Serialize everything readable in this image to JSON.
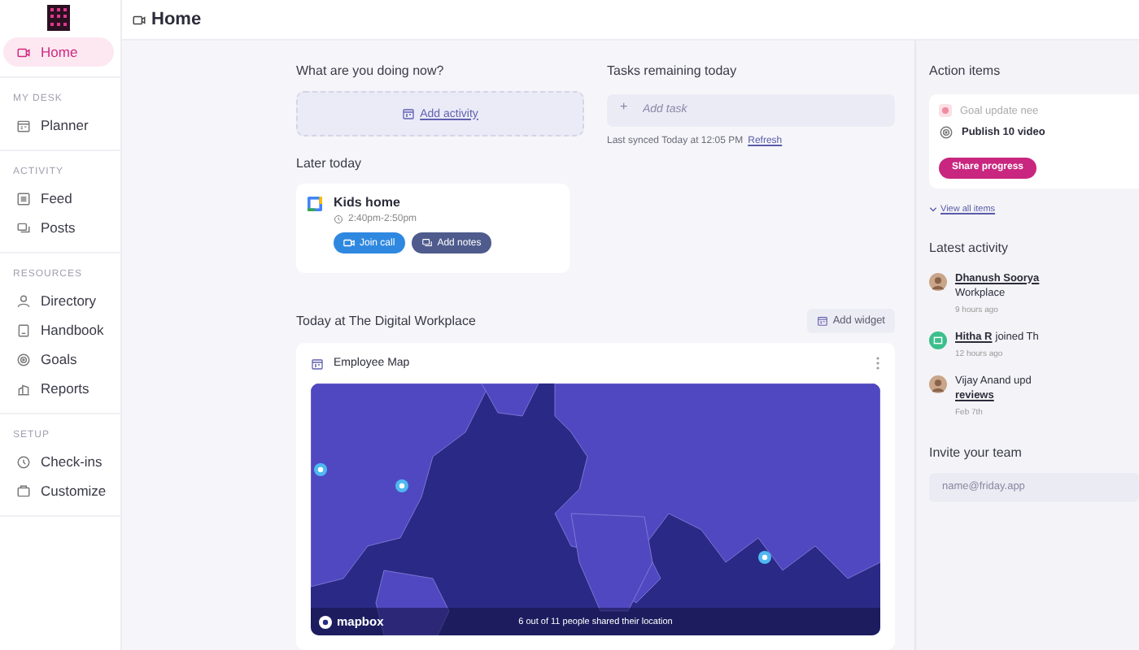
{
  "header": {
    "title": "Home"
  },
  "sidebar": {
    "sections": [
      {
        "items": [
          {
            "label": "Home",
            "selected": true
          }
        ]
      },
      {
        "heading": "MY DESK",
        "items": [
          {
            "label": "Planner",
            "selected": false
          }
        ]
      },
      {
        "heading": "ACTIVITY",
        "items": [
          {
            "label": "Feed",
            "selected": false
          },
          {
            "label": "Posts",
            "selected": false
          }
        ]
      },
      {
        "heading": "RESOURCES",
        "items": [
          {
            "label": "Directory",
            "selected": false
          },
          {
            "label": "Handbook",
            "selected": false
          },
          {
            "label": "Goals",
            "selected": false
          },
          {
            "label": "Reports",
            "selected": false
          }
        ]
      },
      {
        "heading": "SETUP",
        "items": [
          {
            "label": "Check-ins",
            "selected": false
          },
          {
            "label": "Customize",
            "selected": false
          }
        ]
      }
    ]
  },
  "now": {
    "title": "What are you doing now?",
    "action": "Add activity"
  },
  "tasks": {
    "title": "Tasks remaining today",
    "plus": "+",
    "placeholder": "Add task",
    "synced": "Last synced Today at 12:05 PM",
    "refresh": "Refresh"
  },
  "later": {
    "title": "Later today",
    "event": {
      "name": "Kids home",
      "time": "2:40pm-2:50pm",
      "join": "Join call",
      "notes": "Add notes"
    }
  },
  "workplace": {
    "title": "Today at The Digital Workplace",
    "add_widget": "Add widget",
    "widget": {
      "title": "Employee Map",
      "logo": "mapbox",
      "caption": "6 out of 11 people shared their location"
    }
  },
  "action_items": {
    "title": "Action items",
    "goal": "Goal update nee",
    "task": "Publish 10 video",
    "button": "Share progress",
    "view_all": "View all items"
  },
  "latest": {
    "title": "Latest activity",
    "entries": [
      {
        "kind": "photo",
        "lines": [
          [
            {
              "kind": "link",
              "text": "Dhanush Soorya"
            }
          ],
          [
            {
              "kind": "text",
              "text": "Workplace"
            }
          ]
        ],
        "time": "9 hours ago"
      },
      {
        "kind": "badge",
        "lines": [
          [
            {
              "kind": "link",
              "text": "Hitha R"
            },
            {
              "kind": "text",
              "text": "joined Th"
            }
          ]
        ],
        "time": "12 hours ago"
      },
      {
        "kind": "photo",
        "lines": [
          [
            {
              "kind": "text",
              "text": "Vijay Anand upd"
            }
          ],
          [
            {
              "kind": "link",
              "text": "reviews"
            }
          ]
        ],
        "time": "Feb 7th"
      }
    ]
  },
  "invite": {
    "title": "Invite your team",
    "placeholder": "name@friday.app"
  }
}
